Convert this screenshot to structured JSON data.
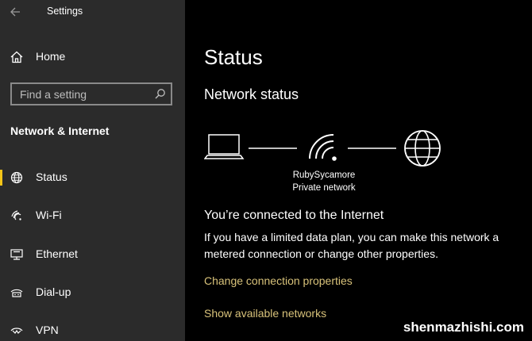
{
  "app": {
    "title": "Settings"
  },
  "sidebar": {
    "home_label": "Home",
    "search": {
      "placeholder": "Find a setting",
      "value": ""
    },
    "section_title": "Network & Internet",
    "items": [
      {
        "label": "Status",
        "icon": "globe-icon",
        "active": true
      },
      {
        "label": "Wi-Fi",
        "icon": "wifi-icon",
        "active": false
      },
      {
        "label": "Ethernet",
        "icon": "ethernet-icon",
        "active": false
      },
      {
        "label": "Dial-up",
        "icon": "dialup-icon",
        "active": false
      },
      {
        "label": "VPN",
        "icon": "vpn-icon",
        "active": false
      }
    ],
    "accent_color": "#f5c518"
  },
  "main": {
    "title": "Status",
    "subtitle": "Network status",
    "network": {
      "name": "RubySycamore",
      "type": "Private network"
    },
    "connected_text": "You’re connected to the Internet",
    "description": "If you have a limited data plan, you can make this network a metered connection or change other properties.",
    "links": [
      "Change connection properties",
      "Show available networks"
    ],
    "link_color": "#d8c27a"
  },
  "watermark": "shenmazhishi.com"
}
